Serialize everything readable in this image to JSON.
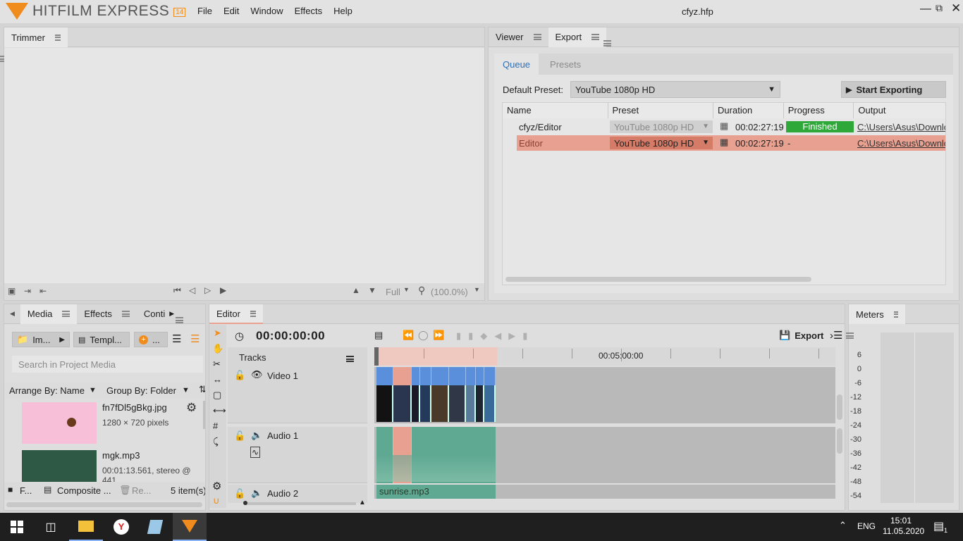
{
  "app": {
    "logo_text": "HITFILM EXPRESS",
    "version": "14",
    "file_name": "cfyz.hfp",
    "menu": [
      "File",
      "Edit",
      "Window",
      "Effects",
      "Help"
    ]
  },
  "trimmer": {
    "tab": "Trimmer",
    "quality": "Full",
    "zoom": "(100.0%)"
  },
  "viewer_panel": {
    "tabs": [
      "Viewer",
      "Export"
    ],
    "subtabs": [
      "Queue",
      "Presets"
    ],
    "default_preset_label": "Default Preset:",
    "default_preset_value": "YouTube 1080p HD",
    "start_button": "Start Exporting",
    "columns": [
      "Name",
      "Preset",
      "Duration",
      "Progress",
      "Output"
    ],
    "rows": [
      {
        "name": "cfyz/Editor",
        "preset": "YouTube 1080p HD",
        "duration": "00:02:27:19",
        "progress": "Finished",
        "output": "C:\\Users\\Asus\\Downlo"
      },
      {
        "name": "Editor",
        "preset": "YouTube 1080p HD",
        "duration": "00:02:27:19",
        "progress": "-",
        "output": "C:\\Users\\Asus\\Downlo"
      }
    ]
  },
  "media_panel": {
    "tabs": [
      "Media",
      "Effects",
      "Conti"
    ],
    "import_btn": "Im...",
    "templates_btn": "Templ...",
    "new_btn": "...",
    "search_placeholder": "Search in Project Media",
    "arrange": "Arrange By: Name",
    "group": "Group By: Folder",
    "items": [
      {
        "name": "fn7fDl5gBkg.jpg",
        "info": "1280 × 720 pixels"
      },
      {
        "name": "mgk.mp3",
        "info": "00:01:13.561, stereo @ 441"
      }
    ],
    "footer_folder": "F...",
    "footer_composite": "Composite ...",
    "footer_remove": "Re...",
    "footer_count": "5 item(s)"
  },
  "editor": {
    "tab": "Editor",
    "timecode": "00:00:00:00",
    "export_btn": "Export",
    "tracks_label": "Tracks",
    "ruler_label": "00:05:00:00",
    "video_track": "Video 1",
    "audio_tracks": [
      "Audio 1",
      "Audio 2"
    ],
    "audio2_clip": "sunrise.mp3"
  },
  "meters": {
    "tab": "Meters",
    "scale": [
      "6",
      "0",
      "-6",
      "-12",
      "-18",
      "-24",
      "-30",
      "-36",
      "-42",
      "-48",
      "-54"
    ]
  },
  "taskbar": {
    "lang": "ENG",
    "time": "15:01",
    "date": "11.05.2020",
    "notifications": "1"
  },
  "colors": {
    "accent": "#f08b1d",
    "queue_highlight": "#e8a090",
    "finished_green": "#2fa83a",
    "video_clip": "#5a8fdc",
    "audio_clip": "#5fa892"
  }
}
